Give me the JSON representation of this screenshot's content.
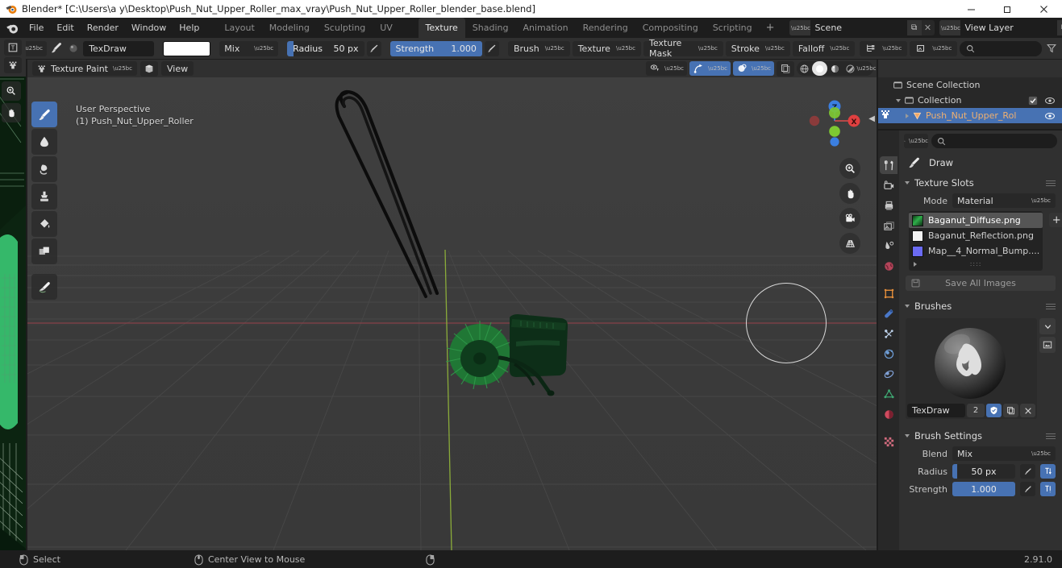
{
  "window": {
    "title": "Blender* [C:\\Users\\a y\\Desktop\\Push_Nut_Upper_Roller_max_vray\\Push_Nut_Upper_Roller_blender_base.blend]",
    "minimize": "–",
    "maximize": "❐",
    "close": "✕"
  },
  "topbar": {
    "menus": [
      "File",
      "Edit",
      "Render",
      "Window",
      "Help"
    ],
    "workspaces": [
      {
        "label": "Layout",
        "active": false
      },
      {
        "label": "Modeling",
        "active": false
      },
      {
        "label": "Sculpting",
        "active": false
      },
      {
        "label": "UV Editing",
        "active": false
      },
      {
        "label": "Texture Paint",
        "active": true
      },
      {
        "label": "Shading",
        "active": false
      },
      {
        "label": "Animation",
        "active": false
      },
      {
        "label": "Rendering",
        "active": false
      },
      {
        "label": "Compositing",
        "active": false
      },
      {
        "label": "Scripting",
        "active": false
      }
    ],
    "add_workspace": "+",
    "scene": {
      "name": "Scene",
      "new_label": "⧉",
      "unlink_label": "✕"
    },
    "view_layer": {
      "name": "View Layer",
      "new_label": "⧉",
      "unlink_label": "✕"
    }
  },
  "tool_settings": {
    "brush_name": "TexDraw",
    "color_hex": "#ffffff",
    "blend_mode": "Mix",
    "radius_label": "Radius",
    "radius_value": "50 px",
    "radius_fill_pct": 8,
    "strength_label": "Strength",
    "strength_value": "1.000",
    "strength_fill_pct": 100,
    "popovers": [
      "Brush",
      "Texture",
      "Texture Mask",
      "Stroke",
      "Falloff"
    ],
    "search_placeholder": ""
  },
  "viewport": {
    "mode": "Texture Paint",
    "view_menu": "View",
    "overlay_line1": "User Perspective",
    "overlay_line2": "(1) Push_Nut_Upper_Roller",
    "tools": [
      {
        "name": "draw-tool",
        "active": true
      },
      {
        "name": "soften-tool",
        "active": false
      },
      {
        "name": "smear-tool",
        "active": false
      },
      {
        "name": "clone-tool",
        "active": false
      },
      {
        "name": "fill-tool",
        "active": false
      },
      {
        "name": "mask-tool",
        "active": false
      },
      {
        "name": "annotate-tool",
        "active": false
      }
    ],
    "gizmo_axes": [
      {
        "label": "Z",
        "color": "#3b7fe0"
      },
      {
        "label": "X",
        "color": "#e04a4a"
      },
      {
        "label": "",
        "color": "#7ec832"
      }
    ],
    "nav_buttons": [
      "zoom-icon",
      "pan-hand-icon",
      "camera-icon",
      "perspective-grid-icon"
    ],
    "shading_modes": [
      {
        "name": "wireframe",
        "active": false
      },
      {
        "name": "solid",
        "active": true
      },
      {
        "name": "material-preview",
        "active": false
      },
      {
        "name": "rendered",
        "active": false
      }
    ]
  },
  "outliner": {
    "rows": [
      {
        "label": "Scene Collection",
        "indent": 0,
        "icon": "collection-icon",
        "expander": "none",
        "checkbox": false,
        "eye": false,
        "selected": false
      },
      {
        "label": "Collection",
        "indent": 1,
        "icon": "collection-icon",
        "expander": "down",
        "checkbox": true,
        "eye": true,
        "selected": false
      },
      {
        "label": "Push_Nut_Upper_Rol",
        "indent": 2,
        "icon": "mesh-object-icon",
        "expander": "right",
        "checkbox": false,
        "eye": true,
        "selected": true
      }
    ]
  },
  "properties": {
    "tool_label": "Draw",
    "tabs": [
      {
        "name": "tool-tab",
        "active": true
      },
      {
        "name": "render-tab",
        "active": false
      },
      {
        "name": "output-tab",
        "active": false
      },
      {
        "name": "view-layer-tab",
        "active": false
      },
      {
        "name": "scene-tab",
        "active": false
      },
      {
        "name": "world-tab",
        "active": false
      },
      {
        "name": "object-tab",
        "active": false
      },
      {
        "name": "modifier-tab",
        "active": false
      },
      {
        "name": "particles-tab",
        "active": false
      },
      {
        "name": "physics-tab",
        "active": false
      },
      {
        "name": "constraints-tab",
        "active": false
      },
      {
        "name": "object-data-tab",
        "active": false
      },
      {
        "name": "material-tab",
        "active": false
      },
      {
        "name": "texture-tab",
        "active": false
      }
    ],
    "texture_slots": {
      "title": "Texture Slots",
      "mode_label": "Mode",
      "mode_value": "Material",
      "slots": [
        {
          "label": "Baganut_Diffuse.png",
          "color": "#1f7a2e",
          "selected": true
        },
        {
          "label": "Baganut_Reflection.png",
          "color": "#f2f2f2",
          "selected": false
        },
        {
          "label": "Map__4_Normal_Bump....",
          "color": "#6b6bf2",
          "selected": false
        }
      ],
      "add_label": "+",
      "save_all_label": "Save All Images"
    },
    "brushes": {
      "title": "Brushes",
      "brush_name": "TexDraw",
      "users_count": "2",
      "fake_user_icon": "shield-icon",
      "duplicate_icon": "copy-icon",
      "unlink_icon": "close-icon"
    },
    "brush_settings": {
      "title": "Brush Settings",
      "blend_label": "Blend",
      "blend_value": "Mix",
      "radius_label": "Radius",
      "radius_value": "50 px",
      "radius_fill_pct": 8,
      "strength_label": "Strength",
      "strength_value": "1.000",
      "strength_fill_pct": 100
    }
  },
  "statusbar": {
    "items": [
      {
        "icon": "mouse-left-icon",
        "label": "Select"
      },
      {
        "icon": "mouse-middle-icon",
        "label": "Center View to Mouse"
      },
      {
        "icon": "mouse-right-icon",
        "label": ""
      }
    ],
    "version": "2.91.0"
  }
}
